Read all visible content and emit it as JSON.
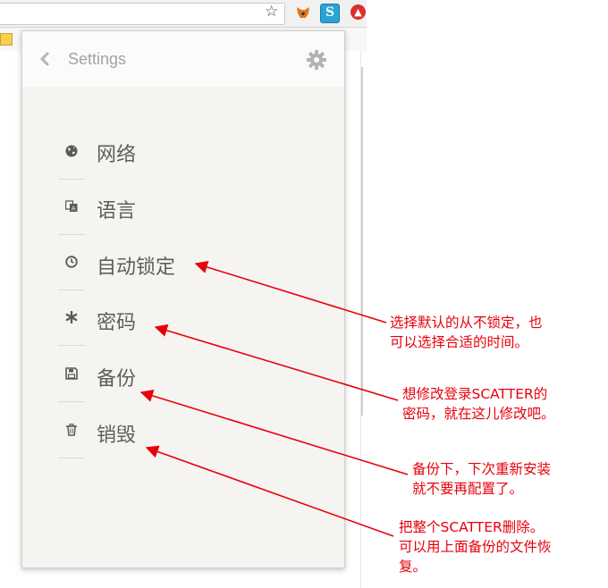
{
  "browser": {
    "star_icon": "bookmark-star-icon",
    "extensions": [
      "metamask-fox-icon",
      "scatter-extension-icon",
      "red-extension-icon"
    ]
  },
  "popup": {
    "header": {
      "title": "Settings",
      "back_icon": "chevron-left-icon",
      "settings_icon": "gear-icon"
    },
    "menu": [
      {
        "label": "网络",
        "icon": "globe-icon"
      },
      {
        "label": "语言",
        "icon": "language-icon"
      },
      {
        "label": "自动锁定",
        "icon": "clock-icon"
      },
      {
        "label": "密码",
        "icon": "asterisk-icon"
      },
      {
        "label": "备份",
        "icon": "floppy-disk-icon"
      },
      {
        "label": "销毁",
        "icon": "trash-icon"
      }
    ]
  },
  "annotations": [
    {
      "text": "选择默认的从不锁定，也\n可以选择合适的时间。"
    },
    {
      "text": "想修改登录SCATTER的\n密码，就在这儿修改吧。"
    },
    {
      "text": "备份下，下次重新安装\n就不要再配置了。"
    },
    {
      "text": "把整个SCATTER删除。\n可以用上面备份的文件恢\n复。"
    }
  ],
  "colors": {
    "annotation": "#e8000b",
    "panel": "#f5f4f1",
    "label": "#5e5e5e",
    "icon": "#5a5a5a"
  }
}
